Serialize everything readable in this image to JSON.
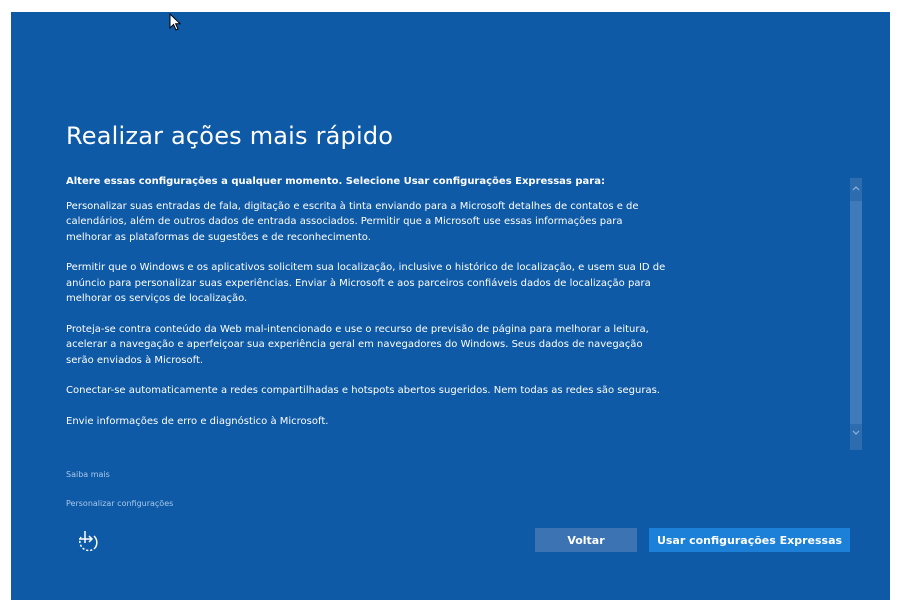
{
  "page": {
    "title": "Realizar ações mais rápido",
    "intro": "Altere essas configurações a qualquer momento. Selecione Usar configurações Expressas para:",
    "paragraphs": [
      "Personalizar suas entradas de fala, digitação e escrita à tinta enviando para a Microsoft detalhes de contatos e de calendários, além de outros dados de entrada associados. Permitir que a Microsoft use essas informações para melhorar as plataformas de sugestões e de reconhecimento.",
      "Permitir que o Windows e os aplicativos solicitem sua localização, inclusive o histórico de localização, e usem sua ID de anúncio para personalizar suas experiências. Enviar à Microsoft e aos parceiros confiáveis dados de localização para melhorar os serviços de localização.",
      "Proteja-se contra conteúdo da Web mal-intencionado e use o recurso de previsão de página para melhorar a leitura, acelerar a navegação e aperfeiçoar sua experiência geral em navegadores do Windows. Seus dados de navegação serão enviados à Microsoft.",
      "Conectar-se automaticamente a redes compartilhadas e hotspots abertos sugeridos. Nem todas as redes são seguras.",
      "Envie informações de erro e diagnóstico à Microsoft."
    ]
  },
  "links": {
    "learn_more": "Saiba mais",
    "customize": "Personalizar configurações"
  },
  "buttons": {
    "back": "Voltar",
    "express": "Usar configurações Expressas"
  },
  "icons": {
    "cursor": "mouse-pointer-icon",
    "ease_of_access": "ease-of-access-icon",
    "scroll_up": "chevron-up-icon",
    "scroll_down": "chevron-down-icon"
  },
  "colors": {
    "background": "#0e5aa6",
    "text": "#ffffff",
    "link": "#a9c8ea",
    "back_button": "#3b73b3",
    "express_button": "#1c80d8"
  }
}
